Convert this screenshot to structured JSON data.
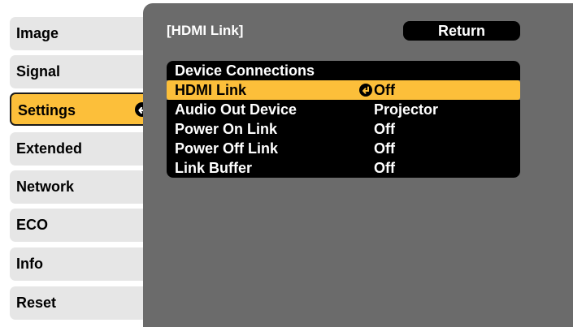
{
  "sidebar": {
    "tabs": [
      {
        "label": "Image"
      },
      {
        "label": "Signal"
      },
      {
        "label": "Settings"
      },
      {
        "label": "Extended"
      },
      {
        "label": "Network"
      },
      {
        "label": "ECO"
      },
      {
        "label": "Info"
      },
      {
        "label": "Reset"
      }
    ],
    "selected_index": 2
  },
  "panel": {
    "breadcrumb": "[HDMI Link]",
    "return_label": "Return",
    "section_header": "Device Connections",
    "rows": [
      {
        "name": "HDMI Link",
        "value": "Off"
      },
      {
        "name": "Audio Out Device",
        "value": "Projector"
      },
      {
        "name": "Power On Link",
        "value": "Off"
      },
      {
        "name": "Power Off Link",
        "value": "Off"
      },
      {
        "name": "Link Buffer",
        "value": "Off"
      }
    ],
    "highlighted_row": 0
  },
  "colors": {
    "highlight": "#fcbf3a",
    "panel_bg": "#6b6b6b",
    "tab_bg": "#e6e6e6"
  },
  "icons": {
    "enter": "enter-icon"
  }
}
